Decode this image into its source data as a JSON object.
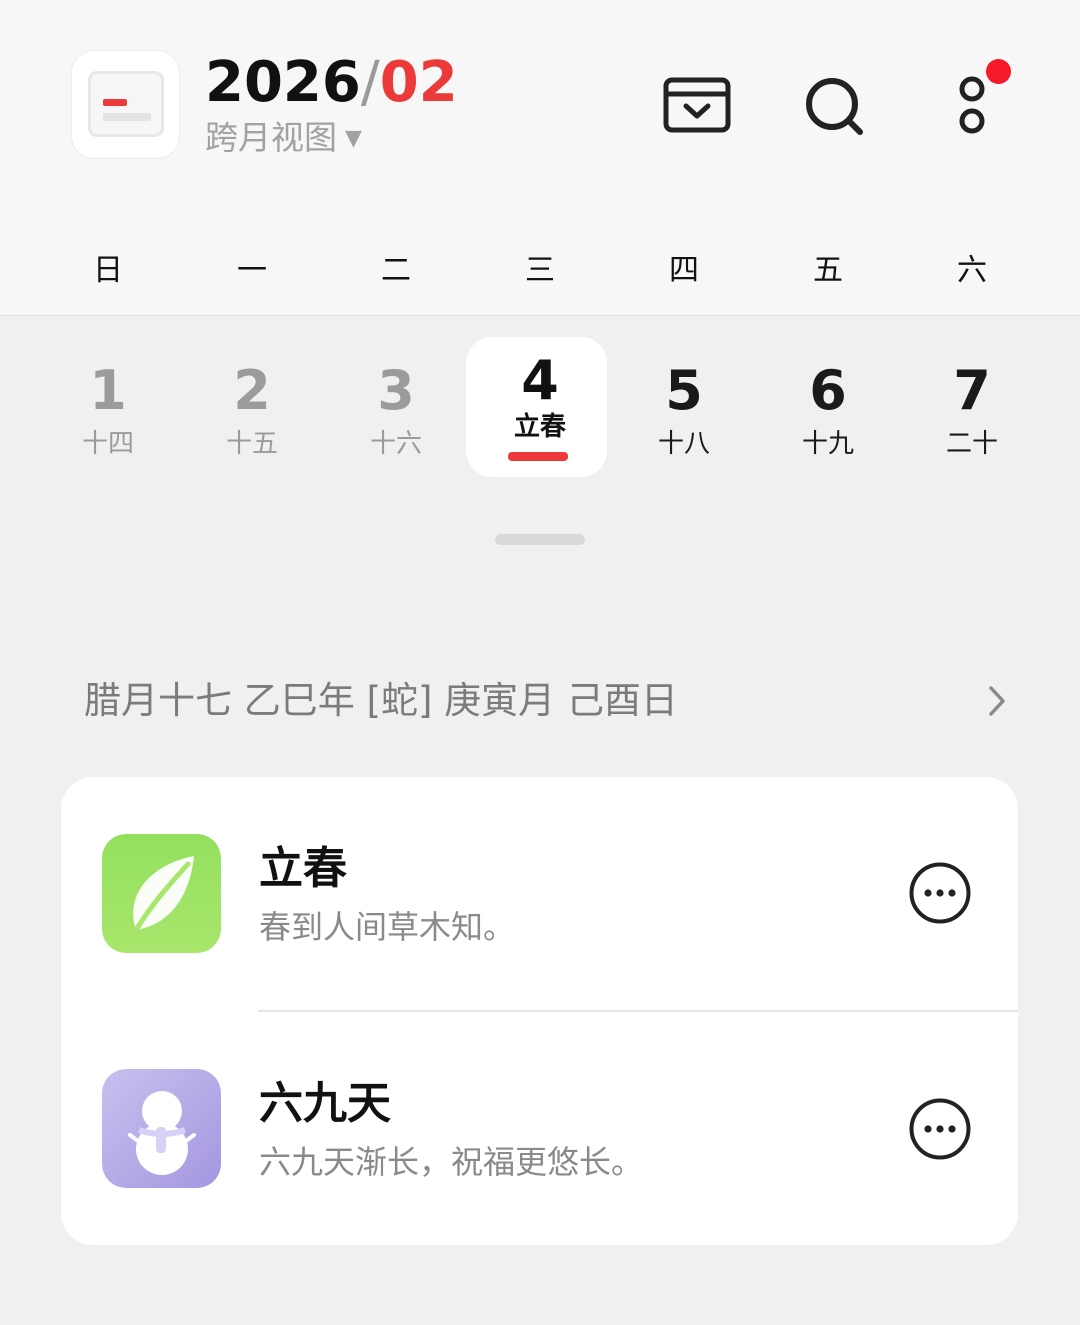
{
  "header": {
    "year": "2026",
    "separator": "/",
    "month": "02",
    "view_label": "跨月视图",
    "view_dropdown_glyph": "▼",
    "icons": [
      "calendar-app-icon",
      "inbox-tray-icon",
      "search-icon",
      "more-settings-icon"
    ],
    "notification_dot_color": "#f5192a",
    "accent_color": "#ec3a3a"
  },
  "weekdays": [
    "日",
    "一",
    "二",
    "三",
    "四",
    "五",
    "六"
  ],
  "dates": [
    {
      "day": "1",
      "lunar": "十四",
      "state": "past"
    },
    {
      "day": "2",
      "lunar": "十五",
      "state": "past"
    },
    {
      "day": "3",
      "lunar": "十六",
      "state": "past"
    },
    {
      "day": "4",
      "lunar": "立春",
      "state": "selected"
    },
    {
      "day": "5",
      "lunar": "十八",
      "state": "future"
    },
    {
      "day": "6",
      "lunar": "十九",
      "state": "future"
    },
    {
      "day": "7",
      "lunar": "二十",
      "state": "future"
    }
  ],
  "lunar_info": "腊月十七 乙巳年 [蛇] 庚寅月 己酉日",
  "events": [
    {
      "title": "立春",
      "subtitle": "春到人间草木知。",
      "icon": "leaf-icon",
      "icon_color": "#8fdc5a"
    },
    {
      "title": "六九天",
      "subtitle": "六九天渐长，祝福更悠长。",
      "icon": "snowman-icon",
      "icon_color": "#b4a8e6"
    }
  ]
}
